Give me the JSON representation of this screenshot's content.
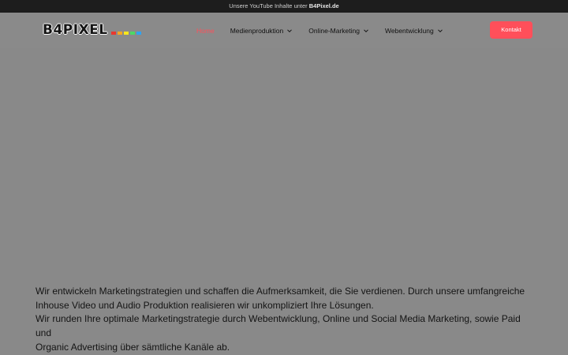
{
  "topbar": {
    "text_prefix": "Unsere YouTube Inhalte unter",
    "text_link": "B4Pixel.de"
  },
  "logo": {
    "text": "B4PIXEL",
    "dot_colors": [
      "#e8382f",
      "#f5a623",
      "#f8e71c",
      "#4cd964",
      "#2ea3f2"
    ]
  },
  "nav": {
    "items": [
      {
        "label": "Home",
        "active": true
      },
      {
        "label": "Medienproduktion"
      },
      {
        "label": "Online-Marketing"
      },
      {
        "label": "Webentwicklung"
      }
    ],
    "contact_label": "Kontakt",
    "accent_color": "#ff4f5a"
  },
  "main": {
    "paragraph_lines": [
      "Wir entwickeln Marketingstrategien und schaffen die Aufmerksamkeit, die Sie verdienen. Durch unsere umfangreiche",
      "Inhouse Video und Audio Produktion realisieren wir unkompliziert Ihre Lösungen.",
      "Wir runden Ihre optimale Marketingstrategie durch Webentwicklung, Online und Social Media Marketing, sowie Paid und",
      "Organic Advertising über sämtliche Kanäle ab."
    ]
  }
}
